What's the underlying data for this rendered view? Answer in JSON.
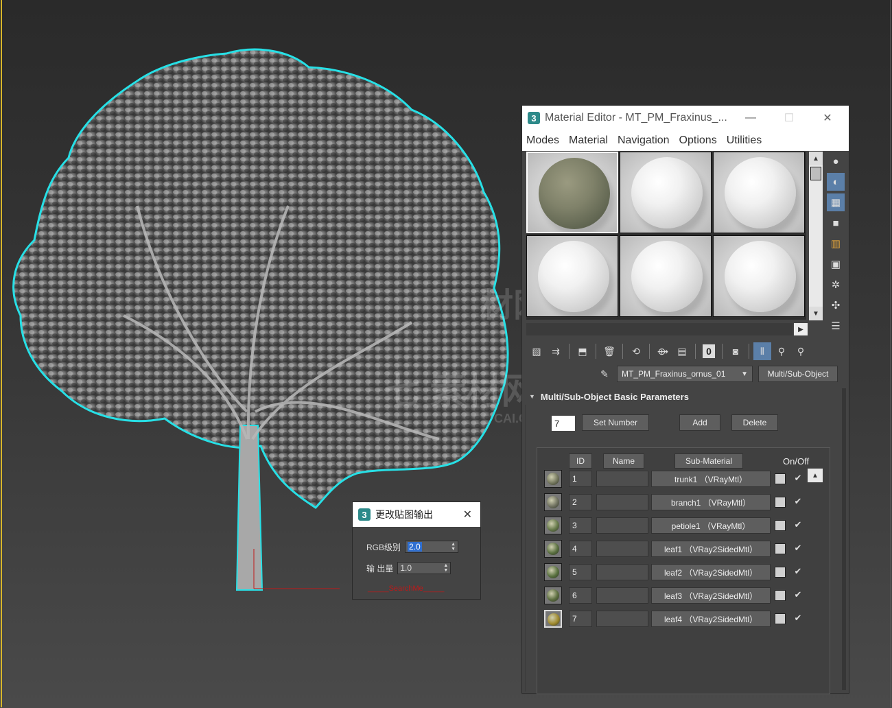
{
  "colors": {
    "viewport_bg": "#3a3a3a",
    "selection_outline": "#27e0e6",
    "button_bg": "#5e5e5e",
    "panel_bg": "#444444",
    "active_tool": "#5b7fa8"
  },
  "material_editor": {
    "title": "Material Editor - MT_PM_Fraxinus_...",
    "app_icon_letter": "3",
    "window_controls": {
      "minimize": "—",
      "maximize": "☐",
      "close": "✕"
    },
    "menu": [
      "Modes",
      "Material",
      "Navigation",
      "Options",
      "Utilities"
    ],
    "material_name": "MT_PM_Fraxinus_ornus_01",
    "material_type": "Multi/Sub-Object",
    "rollout_title": "Multi/Sub-Object Basic Parameters",
    "number_of_submaterials": "7",
    "buttons": {
      "set_number": "Set Number",
      "add": "Add",
      "delete": "Delete"
    },
    "columns": {
      "id": "ID",
      "name": "Name",
      "sub_material": "Sub-Material",
      "on_off": "On/Off"
    },
    "sub_materials": [
      {
        "id": "1",
        "label": "trunk1 （VRayMtl）",
        "color": "#74775e"
      },
      {
        "id": "2",
        "label": "branch1 （VRayMtl）",
        "color": "#6f7160"
      },
      {
        "id": "3",
        "label": "petiole1 （VRayMtl）",
        "color": "#667a4a"
      },
      {
        "id": "4",
        "label": "leaf1 （VRay2SidedMtl）",
        "color": "#5a7040"
      },
      {
        "id": "5",
        "label": "leaf2 （VRay2SidedMtl）",
        "color": "#58703e"
      },
      {
        "id": "6",
        "label": "leaf3 （VRay2SidedMtl）",
        "color": "#5c6e40"
      },
      {
        "id": "7",
        "label": "leaf4 （VRay2SidedMtl）",
        "color": "#a08a2e"
      }
    ],
    "checkbox_glyph": "✔",
    "side_tool_icons": [
      "sphere-icon",
      "backlight-icon",
      "checker-background-icon",
      "sample-uv-icon",
      "video-color-check-icon",
      "make-preview-icon",
      "options-icon",
      "select-by-material-icon",
      "material-map-navigator-icon"
    ],
    "toolbar_icons": [
      "get-material-icon",
      "put-to-scene-icon",
      "assign-to-selection-icon",
      "reset-map-icon",
      "make-unique-icon",
      "put-to-library-icon",
      "save-icon",
      "material-id-channel-icon",
      "show-shaded-icon",
      "show-end-result-icon",
      "go-to-parent-icon",
      "go-forward-sibling-icon"
    ],
    "material_id_channel": "0"
  },
  "output_dialog": {
    "title": "更改贴图输出",
    "rgb_level_label": "RGB级别",
    "rgb_level_value": "2.0",
    "output_amount_label": "输 出量",
    "output_amount_value": "1.0",
    "link": "_____SearchMe_____"
  },
  "watermark": {
    "line1": "材网",
    "line2": "I.COM",
    "line3": "七 素材网",
    "line4": "CAI.COM"
  }
}
